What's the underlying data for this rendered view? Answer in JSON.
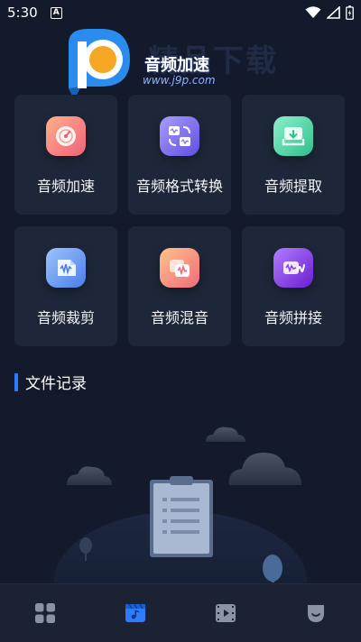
{
  "status_bar": {
    "time": "5:30",
    "notification_badge": "A",
    "icons": [
      "wifi-icon",
      "signal-icon",
      "battery-icon"
    ]
  },
  "watermark": {
    "title": "音频加速",
    "url": "www.j9p.com"
  },
  "tools": [
    {
      "label": "音频加速",
      "icon": "speedometer-icon",
      "color": "#f0607a"
    },
    {
      "label": "音频格式转换",
      "icon": "format-convert-icon",
      "color": "#7a6cf0"
    },
    {
      "label": "音频提取",
      "icon": "extract-icon",
      "color": "#3fd0a0"
    },
    {
      "label": "音频裁剪",
      "icon": "trim-icon",
      "color": "#5a8cf5"
    },
    {
      "label": "音频混音",
      "icon": "mix-icon",
      "color": "#f27a6a"
    },
    {
      "label": "音频拼接",
      "icon": "join-icon",
      "color": "#8a3ff0"
    }
  ],
  "records": {
    "title": "文件记录"
  },
  "bottom_nav": {
    "items": [
      "home-grid-icon",
      "audio-tools-icon",
      "video-icon",
      "profile-icon"
    ],
    "active_index": 1,
    "active_color": "#2e7bff"
  }
}
